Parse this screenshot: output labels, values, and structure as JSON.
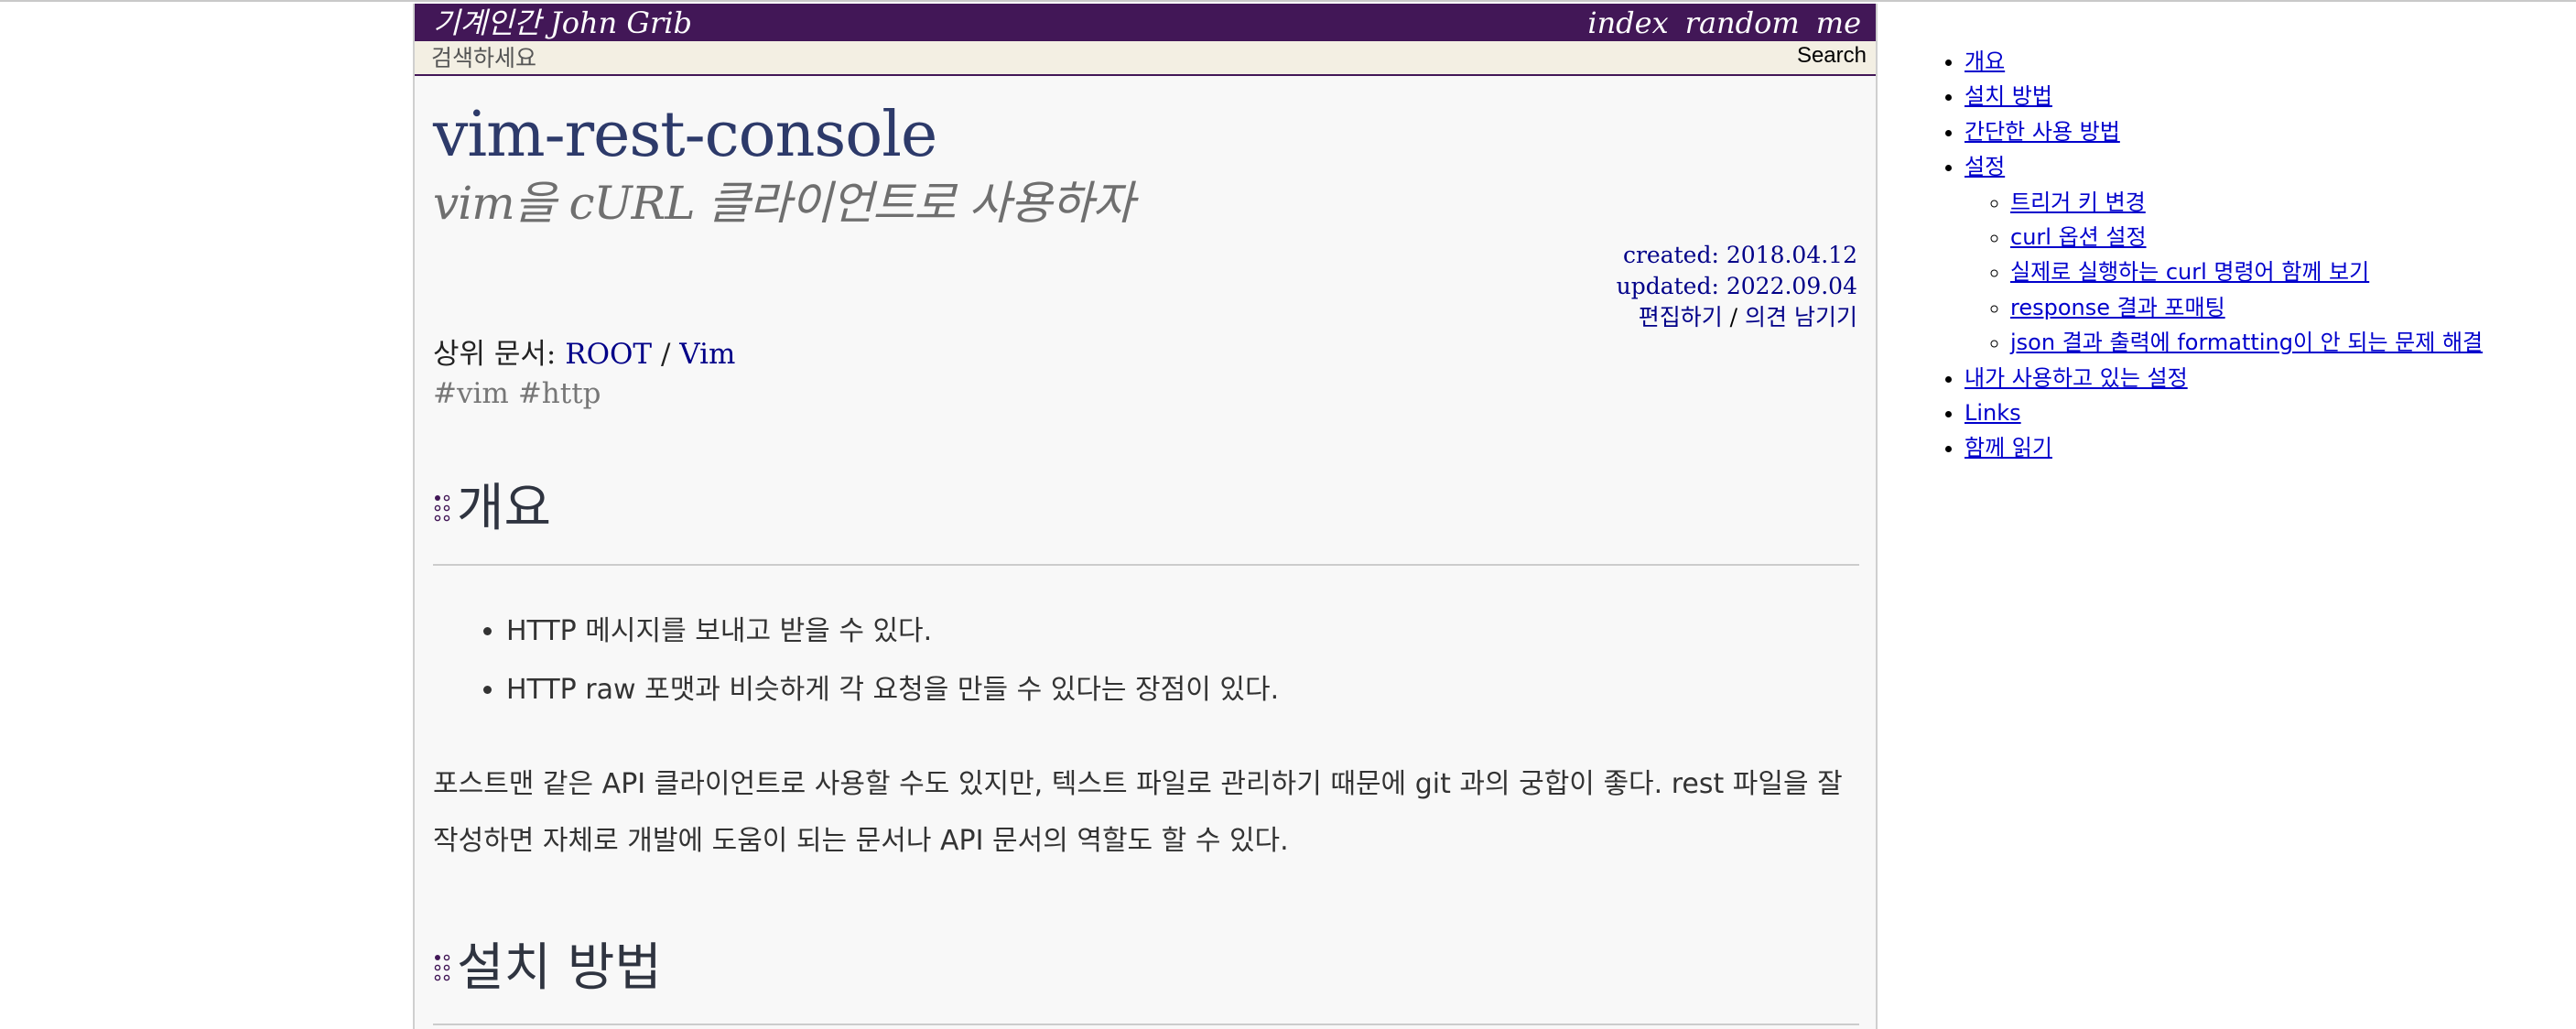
{
  "header": {
    "brand": "기계인간 John Grib",
    "nav": [
      "index",
      "random",
      "me"
    ]
  },
  "search": {
    "placeholder": "검색하세요",
    "button": "Search"
  },
  "article": {
    "title": "vim-rest-console",
    "subtitle": "vim을 cURL 클라이언트로 사용하자",
    "created": "created: 2018.04.12",
    "updated": "updated: 2022.09.04",
    "edit_link": "편집하기",
    "meta_sep": "/",
    "comment_link": "의견 남기기",
    "parent_label": "상위 문서: ",
    "parent_links": [
      "ROOT",
      "Vim"
    ],
    "parent_sep": " / ",
    "tags": [
      "#vim",
      "#http"
    ],
    "sections": [
      {
        "heading": "개요",
        "bullets": [
          "HTTP 메시지를 보내고 받을 수 있다.",
          "HTTP raw 포맷과 비슷하게 각 요청을 만들 수 있다는 장점이 있다."
        ],
        "paragraph": "포스트맨 같은 API 클라이언트로 사용할 수도 있지만, 텍스트 파일로 관리하기 때문에 git 과의 궁합이 좋다. rest 파일을 잘 작성하면 자체로 개발에 도움이 되는 문서나 API 문서의 역할도 할 수 있다."
      },
      {
        "heading": "설치 방법"
      }
    ]
  },
  "toc": {
    "items": [
      "개요",
      "설치 방법",
      "간단한 사용 방법",
      "설정",
      "내가 사용하고 있는 설정",
      "Links",
      "함께 읽기"
    ],
    "sub_items": [
      "트리거 키 변경",
      "curl 옵션 설정",
      "실제로 실행하는 curl 명령어 함께 보기",
      "response 결과 포매팅",
      "json 결과 출력에 formatting이 안 되는 문제 해결"
    ]
  },
  "colors": {
    "header_bg": "#421757",
    "search_bg": "#f3efe3",
    "title": "#2d3a6a",
    "link": "#000088",
    "toc_link": "#0000cc",
    "page_bg": "#f8f8f8"
  },
  "icons": {
    "heading_marker": "heading-dots-icon"
  }
}
